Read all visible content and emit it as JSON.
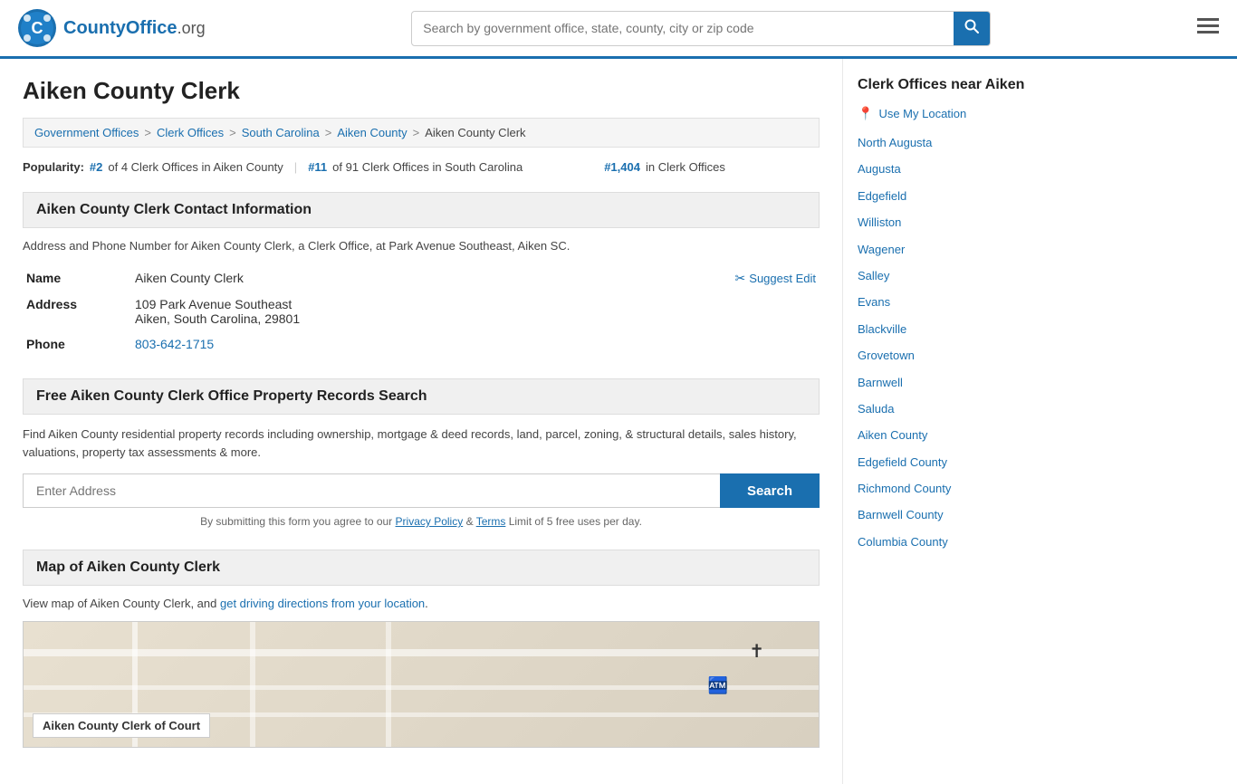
{
  "header": {
    "logo_text": "CountyOffice",
    "logo_suffix": ".org",
    "search_placeholder": "Search by government office, state, county, city or zip code",
    "search_btn_icon": "🔍"
  },
  "page": {
    "title": "Aiken County Clerk",
    "breadcrumb": [
      {
        "label": "Government Offices",
        "href": "#"
      },
      {
        "label": "Clerk Offices",
        "href": "#"
      },
      {
        "label": "South Carolina",
        "href": "#"
      },
      {
        "label": "Aiken County",
        "href": "#"
      },
      {
        "label": "Aiken County Clerk",
        "current": true
      }
    ],
    "popularity": {
      "label": "Popularity:",
      "rank1": "#2",
      "rank1_text": "of 4 Clerk Offices in Aiken County",
      "rank2": "#11",
      "rank2_text": "of 91 Clerk Offices in South Carolina",
      "rank3": "#1,404",
      "rank3_text": "in Clerk Offices"
    }
  },
  "contact": {
    "section_title": "Aiken County Clerk Contact Information",
    "description": "Address and Phone Number for Aiken County Clerk, a Clerk Office, at Park Avenue Southeast, Aiken SC.",
    "name_label": "Name",
    "name_value": "Aiken County Clerk",
    "address_label": "Address",
    "address_line1": "109 Park Avenue Southeast",
    "address_line2": "Aiken, South Carolina, 29801",
    "phone_label": "Phone",
    "phone_value": "803-642-1715",
    "suggest_edit": "Suggest Edit"
  },
  "property_search": {
    "section_title": "Free Aiken County Clerk Office Property Records Search",
    "description": "Find Aiken County residential property records including ownership, mortgage & deed records, land, parcel, zoning, & structural details, sales history, valuations, property tax assessments & more.",
    "input_placeholder": "Enter Address",
    "search_btn_label": "Search",
    "disclaimer_prefix": "By submitting this form you agree to our",
    "privacy_label": "Privacy Policy",
    "and_text": "&",
    "terms_label": "Terms",
    "disclaimer_suffix": "Limit of 5 free uses per day."
  },
  "map_section": {
    "section_title": "Map of Aiken County Clerk",
    "description_prefix": "View map of Aiken County Clerk, and",
    "link_text": "get driving directions from your location",
    "description_suffix": ".",
    "map_label": "Aiken County Clerk of Court"
  },
  "sidebar": {
    "title": "Clerk Offices near Aiken",
    "use_location": "Use My Location",
    "links": [
      "North Augusta",
      "Augusta",
      "Edgefield",
      "Williston",
      "Wagener",
      "Salley",
      "Evans",
      "Blackville",
      "Grovetown",
      "Barnwell",
      "Saluda",
      "Aiken County",
      "Edgefield County",
      "Richmond County",
      "Barnwell County",
      "Columbia County"
    ]
  }
}
